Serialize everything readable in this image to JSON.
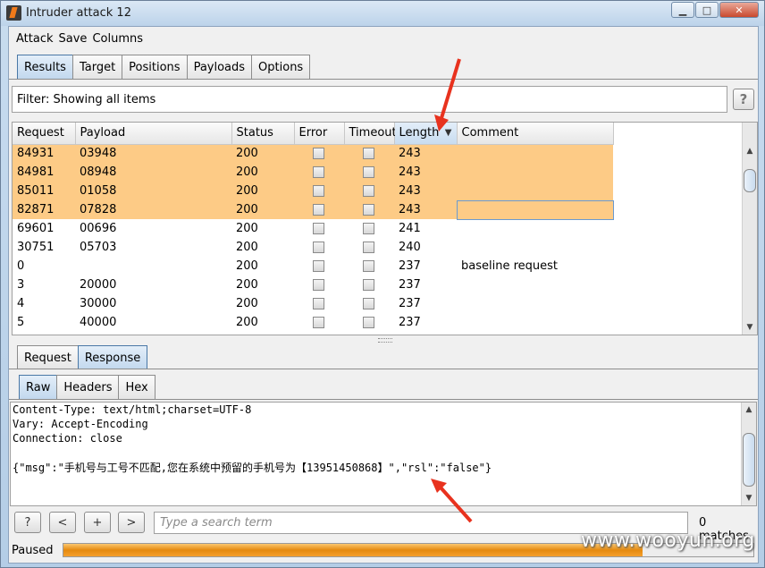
{
  "window": {
    "title": "Intruder attack 12"
  },
  "menu": [
    "Attack",
    "Save",
    "Columns"
  ],
  "main_tabs": [
    {
      "label": "Results",
      "active": true
    },
    {
      "label": "Target",
      "active": false
    },
    {
      "label": "Positions",
      "active": false
    },
    {
      "label": "Payloads",
      "active": false
    },
    {
      "label": "Options",
      "active": false
    }
  ],
  "filter": {
    "text": "Filter: Showing all items",
    "help": "?"
  },
  "table": {
    "columns": [
      "Request",
      "Payload",
      "Status",
      "Error",
      "Timeout",
      "Length",
      "Comment"
    ],
    "sorted_column": "Length",
    "rows": [
      {
        "request": "84931",
        "payload": "03948",
        "status": "200",
        "length": "243",
        "comment": "",
        "highlight": true
      },
      {
        "request": "84981",
        "payload": "08948",
        "status": "200",
        "length": "243",
        "comment": "",
        "highlight": true
      },
      {
        "request": "85011",
        "payload": "01058",
        "status": "200",
        "length": "243",
        "comment": "",
        "highlight": true
      },
      {
        "request": "82871",
        "payload": "07828",
        "status": "200",
        "length": "243",
        "comment": "",
        "highlight": true
      },
      {
        "request": "69601",
        "payload": "00696",
        "status": "200",
        "length": "241",
        "comment": "",
        "highlight": false
      },
      {
        "request": "30751",
        "payload": "05703",
        "status": "200",
        "length": "240",
        "comment": "",
        "highlight": false
      },
      {
        "request": "0",
        "payload": "",
        "status": "200",
        "length": "237",
        "comment": "baseline request",
        "highlight": false
      },
      {
        "request": "3",
        "payload": "20000",
        "status": "200",
        "length": "237",
        "comment": "",
        "highlight": false
      },
      {
        "request": "4",
        "payload": "30000",
        "status": "200",
        "length": "237",
        "comment": "",
        "highlight": false
      },
      {
        "request": "5",
        "payload": "40000",
        "status": "200",
        "length": "237",
        "comment": "",
        "highlight": false
      }
    ]
  },
  "detail_tabs": [
    {
      "label": "Request",
      "active": false
    },
    {
      "label": "Response",
      "active": true
    }
  ],
  "view_tabs": [
    {
      "label": "Raw",
      "active": true
    },
    {
      "label": "Headers",
      "active": false
    },
    {
      "label": "Hex",
      "active": false
    }
  ],
  "response": {
    "lines": [
      "Content-Type: text/html;charset=UTF-8",
      "Vary: Accept-Encoding",
      "Connection: close"
    ],
    "body": "{\"msg\":\"手机号与工号不匹配,您在系统中预留的手机号为【13951450868】\",\"rsl\":\"false\"}"
  },
  "search": {
    "help": "?",
    "prev": "<",
    "add": "+",
    "next": ">",
    "placeholder": "Type a search term",
    "matches": "0 matches"
  },
  "status": {
    "label": "Paused",
    "progress": 0.84
  },
  "watermark": "www.wooyun.org",
  "colors": {
    "highlight_row": "#fdcb86",
    "progress": "#f0960f",
    "annotation_arrow": "#e8321e"
  }
}
